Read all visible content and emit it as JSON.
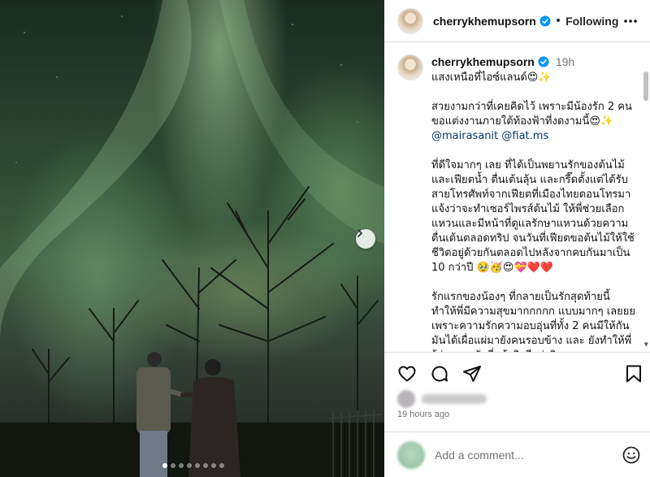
{
  "photo": {
    "alt_people": "couple under aurora",
    "carousel_dots": 8,
    "active_dot": 0,
    "next_icon": "chevron-right-icon"
  },
  "header": {
    "username": "cherrykhemupsorn",
    "separator": "•",
    "follow_label": "Following",
    "more_icon": "more-horizontal-icon",
    "verified_icon": "verified-badge-icon"
  },
  "caption": {
    "username": "cherrykhemupsorn",
    "time": "19h",
    "title": "แสงเหนือที่ไอซ์แลนด์😍✨",
    "para1_text": "สวยงามกว่าที่เคยคิดไว้ เพราะมีน้องรัก 2 คน ขอแต่งงานภายใต้ท้องฟ้าที่งดงามนี้😍✨ ",
    "mention1": "@mairasanit",
    "mention2": "@fiat.ms",
    "para2": "ที่ดีใจมากๆ เลย ที่ได้เป็นพยานรักของต้นไม้และเฟียตน้ำ ตื่นเต้นลุ้น และกรี๊ดตั้งแต่ได้รับสายโทรศัพท์จากเฟียตที่เมืองไทยตอนโทรมาแจ้งว่าจะทำเซอร์ไพรส์ต้นไม้ ให้พี่ช่วยเลือกแหวนและมีหน้าที่ดูแลรักษาแหวนด้วยความตื่นเต้นตลอดทริป จนวันที่เฟียตขอต้นไม้ให้ใช้ชีวิตอยู่ด้วยกันตลอดไปหลังจากคบกันมาเป็น 10 กว่าปี 🥹🥳😍💝❤️❤️",
    "para3": "รักแรกของน้องๆ ที่กลายเป็นรักสุดท้ายนี้ ทำให้พี่มีความสุขมากกกกก แบบมากๆ เลยยย เพราะความรักความอบอุ่นที่ทั้ง 2 คนมีให้กัน มันได้เผื่อแผ่มายังคนรอบข้าง และ ยังทำให้พี่รู้ว่าความรักที่แท้จริงมีอยู่จริง"
  },
  "actions": {
    "like_icon": "heart-icon",
    "comment_icon": "comment-icon",
    "share_icon": "send-icon",
    "save_icon": "bookmark-icon"
  },
  "likes": {
    "blurred_text": "liked by"
  },
  "posted_ago": "19 hours ago",
  "comment": {
    "placeholder": "Add a comment...",
    "emoji_icon": "smile-emoji-icon"
  }
}
